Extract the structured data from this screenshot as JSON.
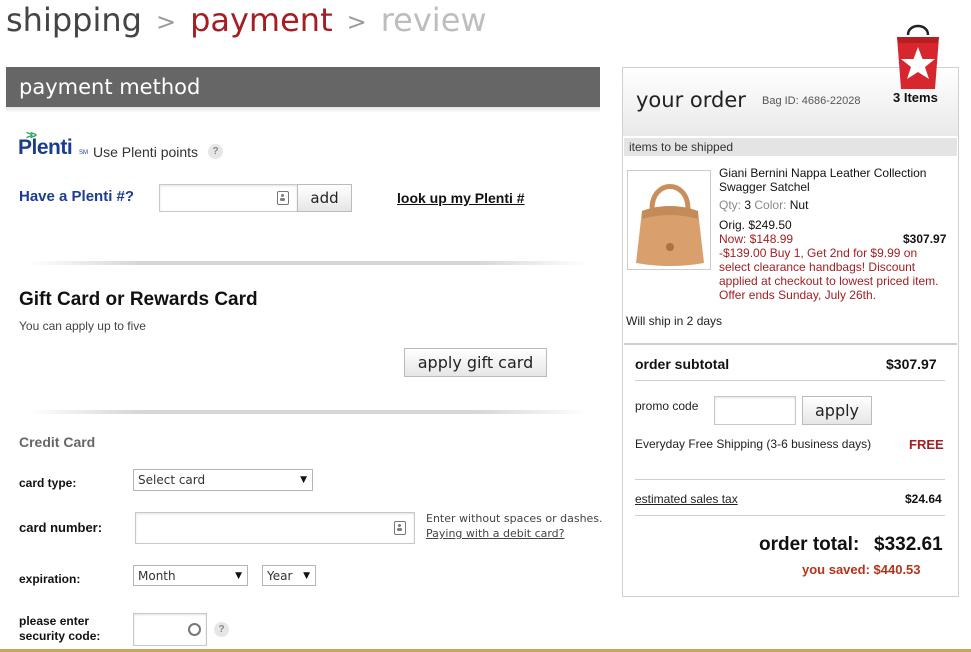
{
  "steps": {
    "shipping": "shipping",
    "payment": "payment",
    "review": "review",
    "separator": ">"
  },
  "payment_method": {
    "header": "payment method",
    "plenti": {
      "logo_text": "Plenti",
      "logo_sm": "SM",
      "use_points": "Use Plenti points",
      "have_label": "Have a Plenti #?",
      "input_value": "",
      "add_button": "add",
      "lookup_link": "look up my Plenti #"
    },
    "gift_card": {
      "title": "Gift Card or Rewards Card",
      "subtitle": "You can apply up to five",
      "apply_button": "apply gift card"
    },
    "credit_card": {
      "title": "Credit Card",
      "card_type_label": "card type:",
      "card_type_value": "Select card",
      "card_number_label": "card number:",
      "card_number_value": "",
      "hint_line1": "Enter without spaces or dashes.",
      "hint_link": "Paying with a debit card?",
      "expiration_label": "expiration:",
      "month_value": "Month",
      "year_value": "Year",
      "security_label_line1": "please enter",
      "security_label_line2": "security code:",
      "security_value": ""
    },
    "help_glyph": "?"
  },
  "order": {
    "title": "your order",
    "bag_id": "Bag ID: 4686-22028",
    "items_count": "3 Items",
    "items_to_ship": "items to be shipped",
    "product": {
      "name": "Giani Bernini Nappa Leather Collection Swagger Satchel",
      "qty_label": "Qty:",
      "qty_value": "3",
      "color_label": "Color:",
      "color_value": "Nut",
      "orig": "Orig. $249.50",
      "now": "Now: $148.99",
      "line_total": "$307.97",
      "promo": "-$139.00 Buy 1, Get 2nd for $9.99 on select clearance handbags! Discount applied at checkout to lowest priced item. Offer ends Sunday, July 26th."
    },
    "will_ship": "Will ship in 2 days",
    "subtotal_label": "order subtotal",
    "subtotal_value": "$307.97",
    "promo_label": "promo code",
    "promo_value": "",
    "promo_button": "apply",
    "shipping_label": "Everyday Free Shipping (3-6 business days)",
    "shipping_value": "FREE",
    "tax_label": "estimated sales tax",
    "tax_value": "$24.64",
    "total_label": "order total:",
    "total_value": "$332.61",
    "saved": "you saved: $440.53"
  },
  "colors": {
    "brand_red": "#a41e22",
    "header_gray": "#666666",
    "plenti_blue": "#1c3d8f",
    "plenti_green": "#25a55a",
    "saved_red": "#b5331b"
  },
  "icons": [
    "shopping-bag-star-icon",
    "plenti-arrows-icon",
    "help-icon",
    "card-field-icon",
    "chevron-down-icon",
    "security-code-icon"
  ]
}
